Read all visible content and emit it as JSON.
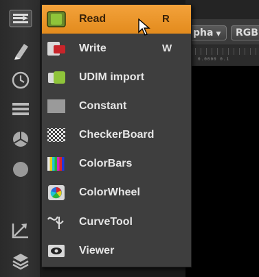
{
  "toolbar": {
    "tools": [
      {
        "icon": "read-tool-icon"
      },
      {
        "icon": "paint-tool-icon"
      },
      {
        "icon": "time-tool-icon"
      },
      {
        "icon": "channel-tool-icon"
      },
      {
        "icon": "color-tool-icon"
      },
      {
        "icon": "filter-tool-icon"
      },
      {
        "icon": "transform-tool-icon"
      },
      {
        "icon": "merge-tool-icon"
      }
    ]
  },
  "viewer": {
    "alpha_label": "pha",
    "rgb_label": "RGB",
    "ruler_text": "0.0000  0.1"
  },
  "menu": {
    "items": [
      {
        "label": "Read",
        "shortcut": "R",
        "icon": "read-icon",
        "highlighted": true
      },
      {
        "label": "Write",
        "shortcut": "W",
        "icon": "write-icon"
      },
      {
        "label": "UDIM import",
        "shortcut": "",
        "icon": "udim-import-icon"
      },
      {
        "label": "Constant",
        "shortcut": "",
        "icon": "constant-icon"
      },
      {
        "label": "CheckerBoard",
        "shortcut": "",
        "icon": "checkerboard-icon"
      },
      {
        "label": "ColorBars",
        "shortcut": "",
        "icon": "colorbars-icon"
      },
      {
        "label": "ColorWheel",
        "shortcut": "",
        "icon": "colorwheel-icon"
      },
      {
        "label": "CurveTool",
        "shortcut": "",
        "icon": "curvetool-icon"
      },
      {
        "label": "Viewer",
        "shortcut": "",
        "icon": "viewer-icon"
      }
    ]
  },
  "colors": {
    "highlight": "#e8931f",
    "menu_bg": "#3e3e3e",
    "text": "#e6e6e6"
  }
}
